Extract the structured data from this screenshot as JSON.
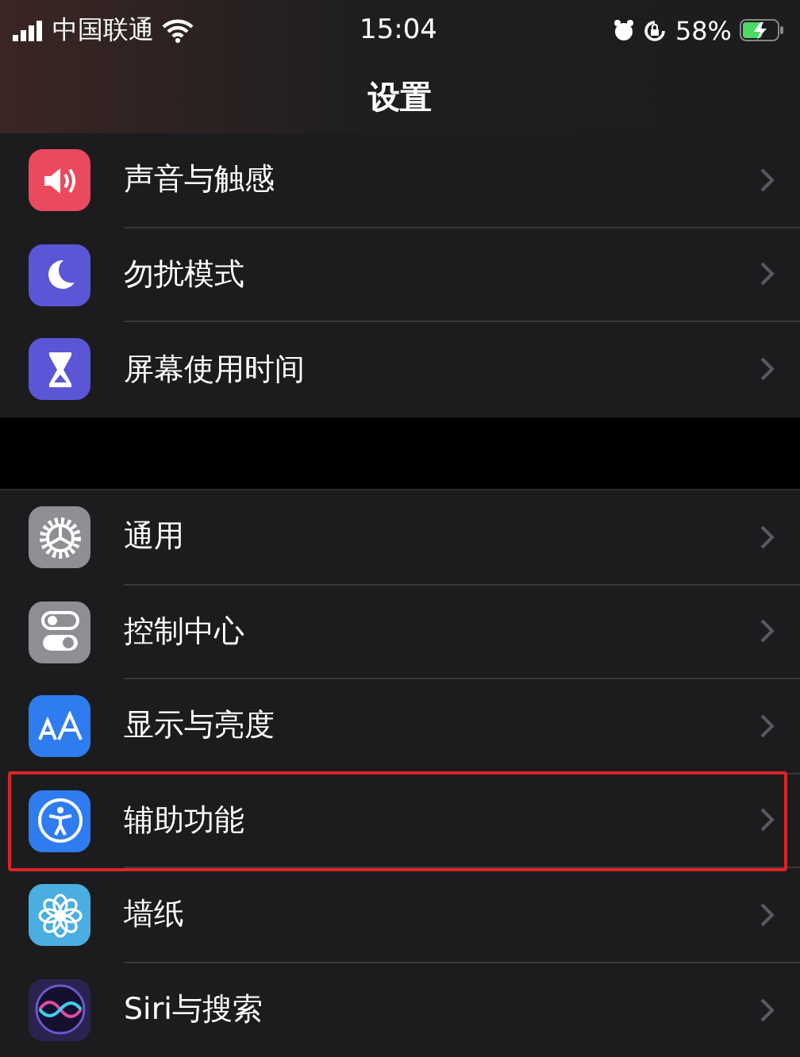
{
  "status_bar": {
    "carrier": "中国联通",
    "time": "15:04",
    "battery": "58%"
  },
  "nav": {
    "title": "设置"
  },
  "groups": [
    {
      "items": [
        {
          "label": "声音与触感",
          "kind": "sound",
          "color": "#eb4a5e",
          "highlighted": false
        },
        {
          "label": "勿扰模式",
          "kind": "moon",
          "color": "#5b56d6",
          "highlighted": false
        },
        {
          "label": "屏幕使用时间",
          "kind": "hourglass",
          "color": "#5b56d6",
          "highlighted": false
        }
      ]
    },
    {
      "items": [
        {
          "label": "通用",
          "kind": "gear",
          "color": "#8e8e93",
          "highlighted": false
        },
        {
          "label": "控制中心",
          "kind": "toggles",
          "color": "#8e8e93",
          "highlighted": false
        },
        {
          "label": "显示与亮度",
          "kind": "text",
          "color": "#2f7cf0",
          "highlighted": false
        },
        {
          "label": "辅助功能",
          "kind": "accessibility",
          "color": "#2f7cf0",
          "highlighted": true
        },
        {
          "label": "墙纸",
          "kind": "flower",
          "color": "#4aaee0",
          "highlighted": false
        },
        {
          "label": "Siri与搜索",
          "kind": "siri",
          "color": "#2b2250",
          "highlighted": false
        }
      ]
    }
  ]
}
